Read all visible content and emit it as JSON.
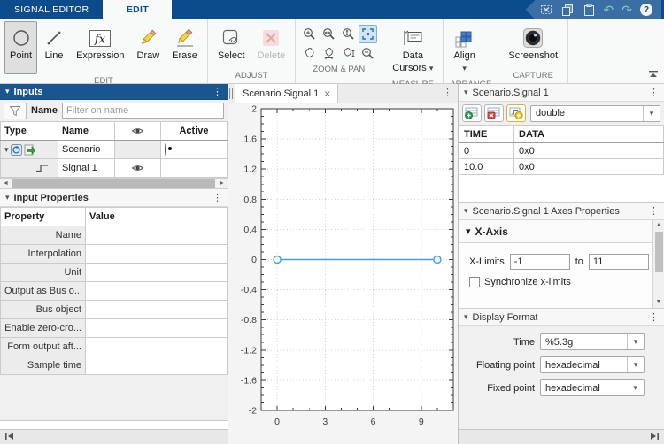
{
  "titlebar": {
    "tab_signal_editor": "SIGNAL EDITOR",
    "tab_edit": "EDIT"
  },
  "toolstrip": {
    "point": "Point",
    "line": "Line",
    "expression": "Expression",
    "draw": "Draw",
    "erase": "Erase",
    "select": "Select",
    "delete": "Delete",
    "data_cursors_line1": "Data",
    "data_cursors_line2": "Cursors",
    "align": "Align",
    "screenshot": "Screenshot",
    "sections": {
      "edit": "EDIT",
      "adjust": "ADJUST",
      "zoom_pan": "ZOOM & PAN",
      "measure": "MEASURE",
      "arrange": "ARRANGE",
      "capture": "CAPTURE"
    }
  },
  "inputs_panel": {
    "title": "Inputs",
    "filter_label": "Name",
    "filter_placeholder": "Filter on name",
    "col_type": "Type",
    "col_name": "Name",
    "col_active": "Active",
    "rows": [
      {
        "name": "Scenario"
      },
      {
        "name": "Signal 1"
      }
    ]
  },
  "properties_panel": {
    "title": "Input Properties",
    "col_property": "Property",
    "col_value": "Value",
    "rows": [
      "Name",
      "Interpolation",
      "Unit",
      "Output as Bus o...",
      "Bus object",
      "Enable zero-cro...",
      "Form output aft...",
      "Sample time"
    ]
  },
  "document": {
    "tab_title": "Scenario.Signal 1"
  },
  "chart_data": {
    "type": "line",
    "title": "",
    "xlabel": "",
    "ylabel": "",
    "xlim": [
      -1,
      11
    ],
    "ylim": [
      -2,
      2
    ],
    "xticks": [
      0,
      3,
      6,
      9
    ],
    "x_minor_step": 1,
    "ytick_step": 0.4,
    "y_minor_step": 0.1,
    "grid": true,
    "legend": false,
    "series": [
      {
        "name": "Signal 1",
        "x": [
          0,
          10
        ],
        "y": [
          0,
          0
        ],
        "color": "#4a9dd6",
        "marker": "circle"
      }
    ]
  },
  "signal_panel": {
    "title": "Scenario.Signal 1",
    "dtype": "double",
    "col_time": "TIME",
    "col_data": "DATA",
    "rows": [
      [
        "0",
        "0x0"
      ],
      [
        "10.0",
        "0x0"
      ]
    ]
  },
  "axes_panel": {
    "title": "Scenario.Signal 1 Axes Properties",
    "xaxis_header": "X-Axis",
    "xlimits_label": "X-Limits",
    "xmin": "-1",
    "to_label": "to",
    "xmax": "11",
    "sync_label": "Synchronize x-limits"
  },
  "display_panel": {
    "title": "Display Format",
    "time_label": "Time",
    "time_value": "%5.3g",
    "floating_label": "Floating point",
    "floating_value": "hexadecimal",
    "fixed_label": "Fixed point",
    "fixed_value": "hexadecimal"
  },
  "icons": {
    "chevron_down": "▾",
    "ellipsis": "⋮",
    "close": "×",
    "scroll_left": "◄",
    "scroll_right": "►",
    "scroll_up": "▲",
    "scroll_down": "▼",
    "undo": "↶",
    "redo": "↷",
    "help": "?"
  }
}
